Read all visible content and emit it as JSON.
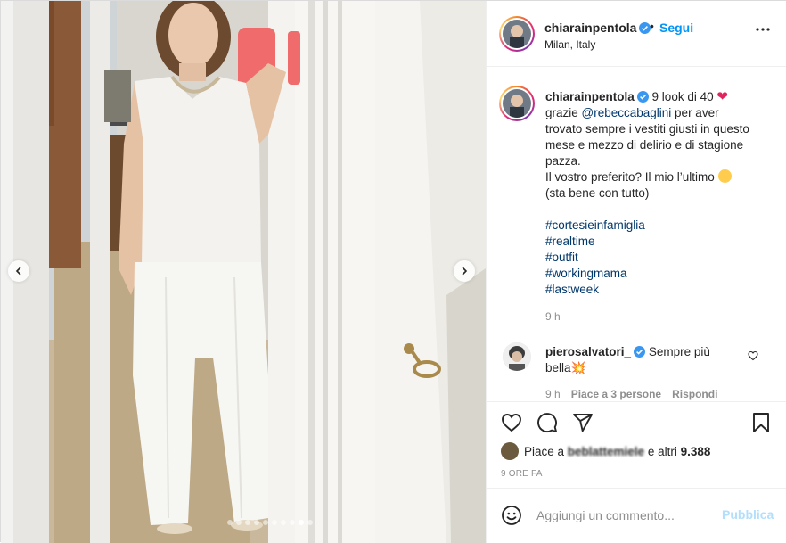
{
  "post": {
    "photo_alt": "",
    "carousel": {
      "total_slides": 10,
      "active_slide": 9
    },
    "icons": {
      "prev": "chevron-left-icon",
      "next": "chevron-right-icon"
    }
  },
  "header": {
    "username": "chiarainpentola",
    "dot": "•",
    "follow_label": "Segui",
    "location": "Milan, Italy",
    "more_icon": "more-options-icon"
  },
  "caption": {
    "username": "chiarainpentola",
    "line1_text": "9 look di 40",
    "line2_pre": "grazie ",
    "mention": "@rebeccabaglini",
    "line2_post": " per aver trovato sempre i vestiti giusti in questo mese e mezzo di delirio e di stagione pazza.",
    "line3": "Il vostro preferito? Il mio l’ultimo",
    "line4": "(sta bene con tutto)",
    "hashtags": [
      "#cortesieinfamiglia",
      "#realtime",
      "#outfit",
      "#workingmama",
      "#lastweek"
    ],
    "time": "9 h"
  },
  "comment": {
    "username": "pierosalvatori_",
    "text_line1": "Sempre più",
    "text_line2": "bella",
    "time": "9 h",
    "likes": "Piace a 3 persone",
    "reply_label": "Rispondi"
  },
  "actions": {
    "like_icon": "heart-outline-icon",
    "comment_icon": "comment-bubble-icon",
    "share_icon": "paper-plane-icon",
    "save_icon": "bookmark-icon"
  },
  "likes": {
    "prefix": "Piace a ",
    "user": "beblattemiele",
    "suffix": " e altri ",
    "count": "9.388"
  },
  "date": "9 ORE FA",
  "add_comment": {
    "placeholder": "Aggiungi un commento...",
    "publish_label": "Pubblica",
    "emoji_icon": "smiley-icon"
  },
  "colors": {
    "accent": "#0095f6",
    "link": "#00376b",
    "muted": "#8e8e8e",
    "publish_disabled": "#b2dffc",
    "border": "#efefef"
  }
}
